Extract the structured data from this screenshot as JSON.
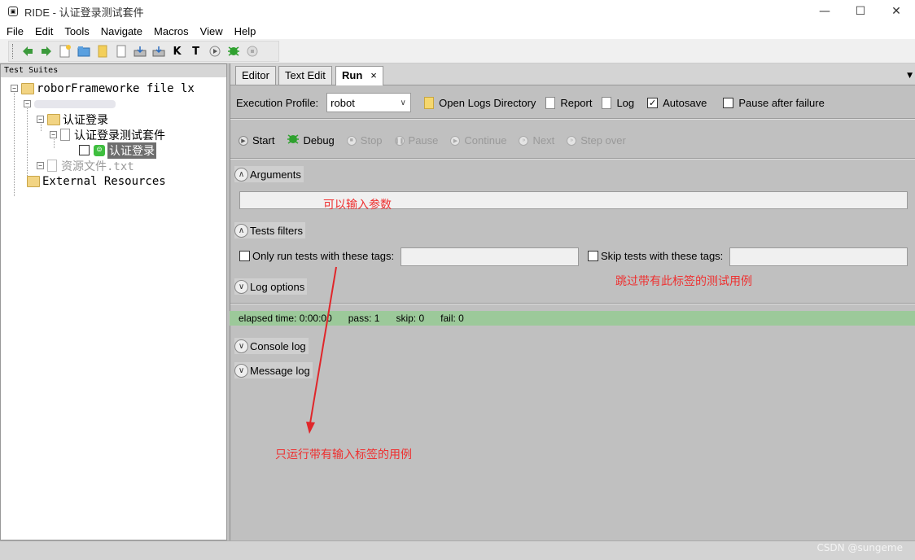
{
  "window": {
    "title": "RIDE - 认证登录测试套件",
    "controls": {
      "minimize": "—",
      "maximize": "☐",
      "close": "✕"
    }
  },
  "menu": [
    "File",
    "Edit",
    "Tools",
    "Navigate",
    "Macros",
    "View",
    "Help"
  ],
  "toolbar": {
    "icons": [
      "back-icon",
      "forward-icon",
      "new-project-icon",
      "open-folder-icon",
      "open-directory-icon",
      "new-file-icon",
      "save-icon",
      "save-all-icon",
      "search-keywords-icon",
      "search-tests-icon",
      "run-icon",
      "debug-icon",
      "stop-icon"
    ],
    "keyword_letter": "K",
    "test_letter": "T"
  },
  "tree": {
    "header": "Test Suites",
    "root": "roborFrameworke file lx",
    "blurred_child": "",
    "suite": "认证登录",
    "suite_file": "认证登录测试套件",
    "test_case": "认证登录",
    "resource": "资源文件.txt",
    "external": "External Resources"
  },
  "tabs": [
    {
      "label": "Editor"
    },
    {
      "label": "Text Edit"
    },
    {
      "label": "Run",
      "close": "×"
    }
  ],
  "run": {
    "execution_profile_label": "Execution Profile:",
    "execution_profile_value": "robot",
    "open_logs_label": "Open Logs Directory",
    "report_label": "Report",
    "log_label": "Log",
    "autosave_label": "Autosave",
    "autosave_checked": "✓",
    "pause_after_failure_label": "Pause after failure",
    "buttons": {
      "start": "Start",
      "debug": "Debug",
      "stop": "Stop",
      "pause": "Pause",
      "continue": "Continue",
      "next": "Next",
      "step_over": "Step over"
    },
    "arguments_label": "Arguments",
    "tests_filters_label": "Tests filters",
    "only_run_label": "Only run tests with these tags:",
    "skip_label": "Skip tests with these tags:",
    "log_options_label": "Log options",
    "status": {
      "elapsed": "elapsed time: 0:00:00",
      "pass": "pass: 1",
      "skip": "skip: 0",
      "fail": "fail: 0"
    },
    "console_log_label": "Console log",
    "message_log_label": "Message log"
  },
  "annotations": {
    "arguments_note": "可以输入参数",
    "skip_note": "跳过带有此标签的测试用例",
    "only_note": "只运行带有输入标签的用例"
  },
  "watermark": "CSDN @sungeme",
  "colors": {
    "status_pass": "#9cc99a",
    "annotation": "#ee3030",
    "arrow": "#e0262a"
  }
}
